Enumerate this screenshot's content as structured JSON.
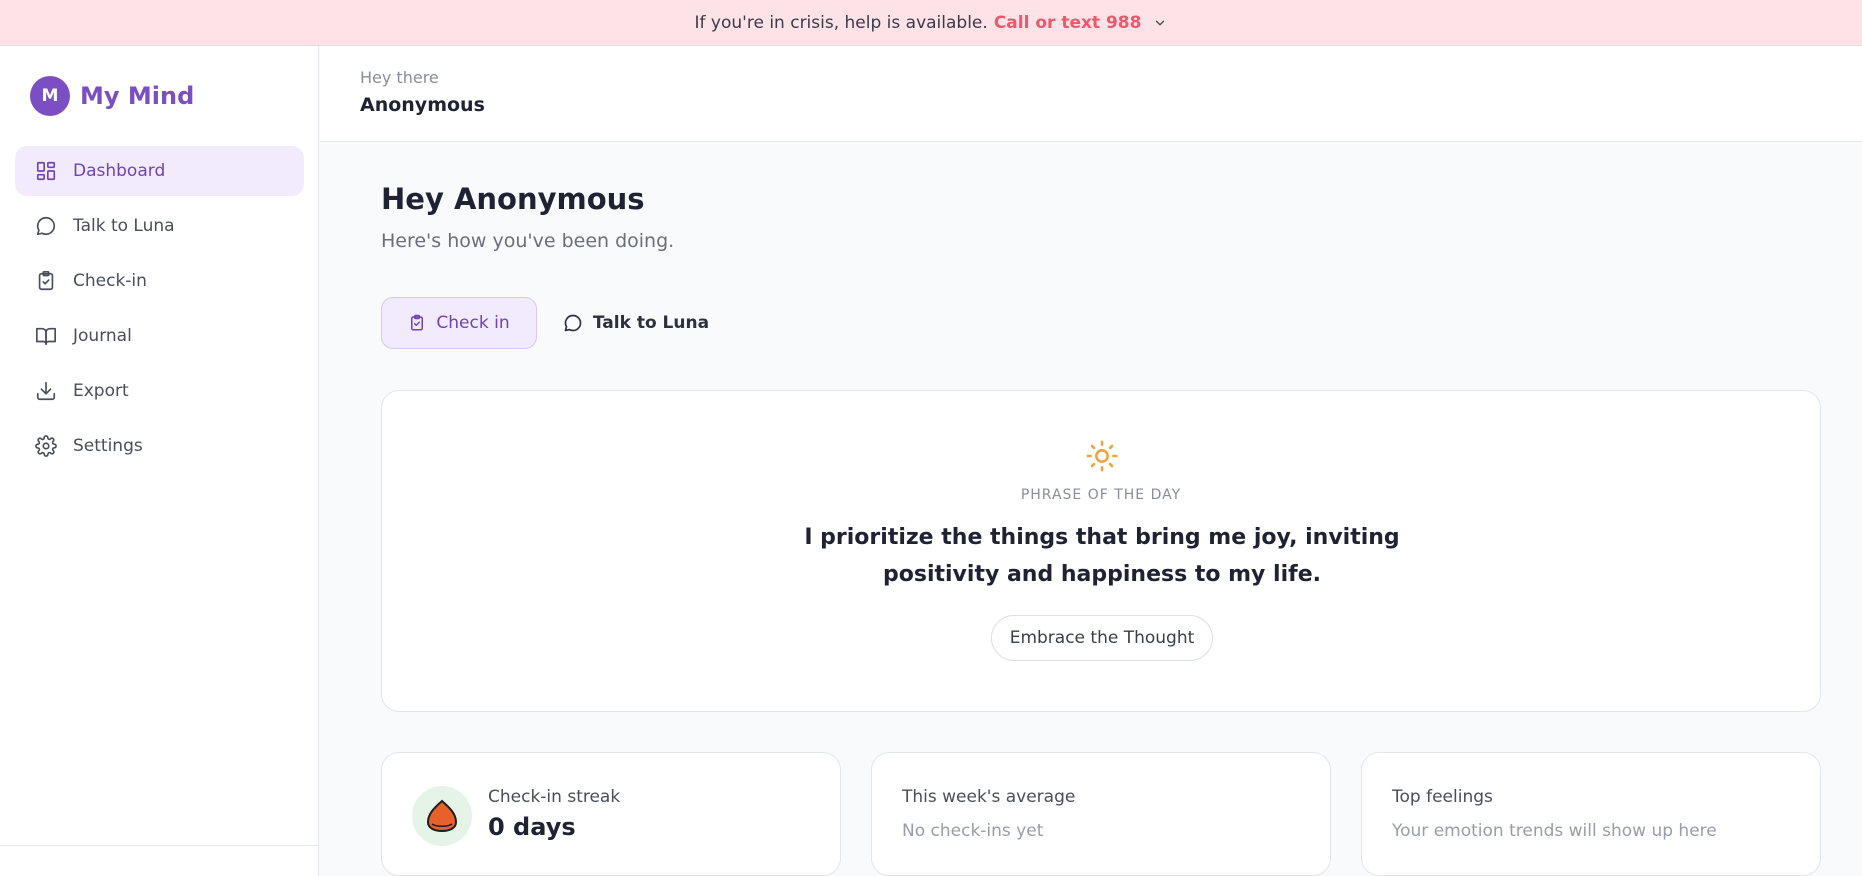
{
  "crisis": {
    "text": "If you're in crisis, help is available.",
    "cta": "Call or text 988"
  },
  "brand": {
    "initial": "M",
    "name": "My Mind"
  },
  "nav": [
    {
      "label": "Dashboard",
      "icon": "dashboard-icon"
    },
    {
      "label": "Talk to Luna",
      "icon": "chat-bubble-icon"
    },
    {
      "label": "Check-in",
      "icon": "clipboard-check-icon"
    },
    {
      "label": "Journal",
      "icon": "book-icon"
    },
    {
      "label": "Export",
      "icon": "download-icon"
    },
    {
      "label": "Settings",
      "icon": "gear-icon"
    }
  ],
  "topbar": {
    "greeting": "Hey there",
    "user": "Anonymous"
  },
  "main": {
    "title": "Hey Anonymous",
    "subtitle": "Here's how you've been doing.",
    "actions": {
      "checkin": "Check in",
      "luna": "Talk to Luna"
    }
  },
  "phrase": {
    "label": "PHRASE OF THE DAY",
    "quote": "I prioritize the things that bring me joy, inviting positivity and happiness to my life.",
    "button": "Embrace the Thought"
  },
  "stats": {
    "streak": {
      "title": "Check-in streak",
      "value": "0 days"
    },
    "average": {
      "title": "This week's average",
      "value": "No check-ins yet"
    },
    "feelings": {
      "title": "Top feelings",
      "value": "Your emotion trends will show up here"
    }
  },
  "colors": {
    "accent": "#7b4fc3",
    "crisis_bg": "#fde3e8",
    "crisis_cta": "#ea5a6a",
    "sun": "#f2a33a",
    "streak_icon": "#e8602a"
  }
}
